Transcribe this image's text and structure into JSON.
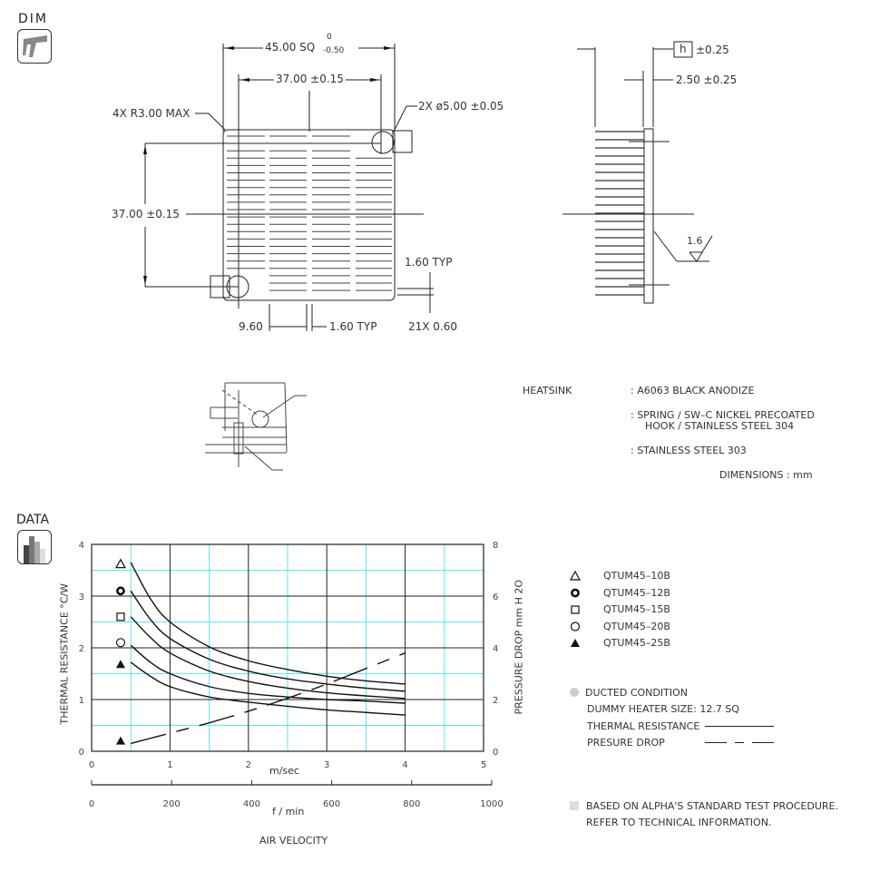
{
  "sections": {
    "dim_title": "DIM",
    "data_title": "DATA"
  },
  "icons": {
    "dim": "caliper-icon",
    "data": "bar-chart-icon"
  },
  "drawing": {
    "top_view": {
      "overall_dim": "45.00 SQ",
      "overall_tol_upper": "0",
      "overall_tol_lower": "-0.50",
      "hole_spacing_x": "37.00 ±0.15",
      "hole_spacing_y": "37.00 ±0.15",
      "corner_radius": "4X R3.00 MAX",
      "hole_dia": "2X ø5.00 ±0.05",
      "fin_pitch": "1.60 TYP",
      "fin_thickness": "21X 0.60",
      "slot_pitch_a": "9.60",
      "slot_pitch_b": "1.60 TYP"
    },
    "side_view": {
      "height_symbol": "h",
      "height_tol": "±0.25",
      "base_thickness": "2.50 ±0.25",
      "surface_finish": "1.6"
    }
  },
  "materials": {
    "heatsink_label": "HEATSINK",
    "heatsink_value": ": A6063  BLACK ANODIZE",
    "spring_line1": ": SPRING / SW–C NICKEL PRECOATED",
    "spring_line2": "HOOK / STAINLESS STEEL 304",
    "pin_value": ": STAINLESS STEEL 303",
    "units": "DIMENSIONS :  mm"
  },
  "legend": {
    "items": [
      {
        "marker": "open-triangle",
        "label": "QTUM45–10B"
      },
      {
        "marker": "bold-circle",
        "label": "QTUM45–12B"
      },
      {
        "marker": "open-square",
        "label": "QTUM45–15B"
      },
      {
        "marker": "open-circle",
        "label": "QTUM45–20B"
      },
      {
        "marker": "filled-triangle",
        "label": "QTUM45–25B"
      }
    ],
    "condition_title": "DUCTED CONDITION",
    "heater_size": "DUMMY HEATER SIZE: 12.7 SQ",
    "thermal_label": "THERMAL RESISTANCE",
    "pressure_label": "PRESURE DROP",
    "footnote_line1": "BASED ON ALPHA'S STANDARD TEST PROCEDURE.",
    "footnote_line2": "REFER TO TECHNICAL INFORMATION."
  },
  "chart_data": {
    "type": "line",
    "title": "",
    "xlabel": "m/sec",
    "xlabel2": "f / min",
    "xlabel_main": "AIR VELOCITY",
    "ylabel": "THERMAL RESISTANCE  °C/W",
    "ylabel_right": "PRESSURE  DROP   mm H 2O",
    "xlim": [
      0,
      5
    ],
    "ylim": [
      0,
      4
    ],
    "ylim_right": [
      0,
      8
    ],
    "x_ticks": [
      "0",
      "1",
      "2",
      "3",
      "4",
      "5"
    ],
    "x2_ticks": [
      "0",
      "200",
      "400",
      "600",
      "800",
      "1000"
    ],
    "y_ticks": [
      "0",
      "1",
      "2",
      "3",
      "4"
    ],
    "y_right_ticks": [
      "0",
      "2",
      "4",
      "6",
      "8"
    ],
    "grid": true,
    "legend_position": "right",
    "x": [
      0.5,
      0.75,
      1.0,
      1.5,
      2.0,
      2.5,
      3.0,
      3.5,
      4.0
    ],
    "series": [
      {
        "name": "QTUM45-10B",
        "axis": "left",
        "style": "solid",
        "values": [
          3.65,
          2.95,
          2.5,
          2.02,
          1.75,
          1.58,
          1.45,
          1.36,
          1.3
        ]
      },
      {
        "name": "QTUM45-12B",
        "axis": "left",
        "style": "solid",
        "values": [
          3.1,
          2.55,
          2.18,
          1.78,
          1.55,
          1.4,
          1.3,
          1.22,
          1.16
        ]
      },
      {
        "name": "QTUM45-15B",
        "axis": "left",
        "style": "solid",
        "values": [
          2.6,
          2.2,
          1.9,
          1.55,
          1.35,
          1.22,
          1.13,
          1.07,
          1.02
        ]
      },
      {
        "name": "QTUM45-20B",
        "axis": "left",
        "style": "solid",
        "values": [
          2.05,
          1.72,
          1.5,
          1.25,
          1.12,
          1.05,
          1.0,
          0.97,
          0.93
        ]
      },
      {
        "name": "QTUM45-25B",
        "axis": "left",
        "style": "solid",
        "values": [
          1.72,
          1.45,
          1.25,
          1.05,
          0.95,
          0.87,
          0.8,
          0.75,
          0.7
        ]
      },
      {
        "name": "Pressure Drop",
        "axis": "right",
        "style": "dashed",
        "values": [
          0.3,
          0.5,
          0.7,
          1.1,
          1.55,
          2.05,
          2.6,
          3.2,
          3.8
        ]
      }
    ],
    "markers": [
      {
        "series": "QTUM45-10B",
        "marker": "open-triangle",
        "x": 0.37,
        "y": 3.62
      },
      {
        "series": "QTUM45-12B",
        "marker": "bold-circle",
        "x": 0.37,
        "y": 3.1
      },
      {
        "series": "QTUM45-15B",
        "marker": "open-square",
        "x": 0.37,
        "y": 2.6
      },
      {
        "series": "QTUM45-20B",
        "marker": "open-circle",
        "x": 0.37,
        "y": 2.1
      },
      {
        "series": "QTUM45-25B",
        "marker": "filled-triangle",
        "x": 0.37,
        "y": 1.68
      },
      {
        "series": "Pressure Drop",
        "marker": "filled-triangle",
        "x": 0.37,
        "y": 0.2
      }
    ]
  }
}
